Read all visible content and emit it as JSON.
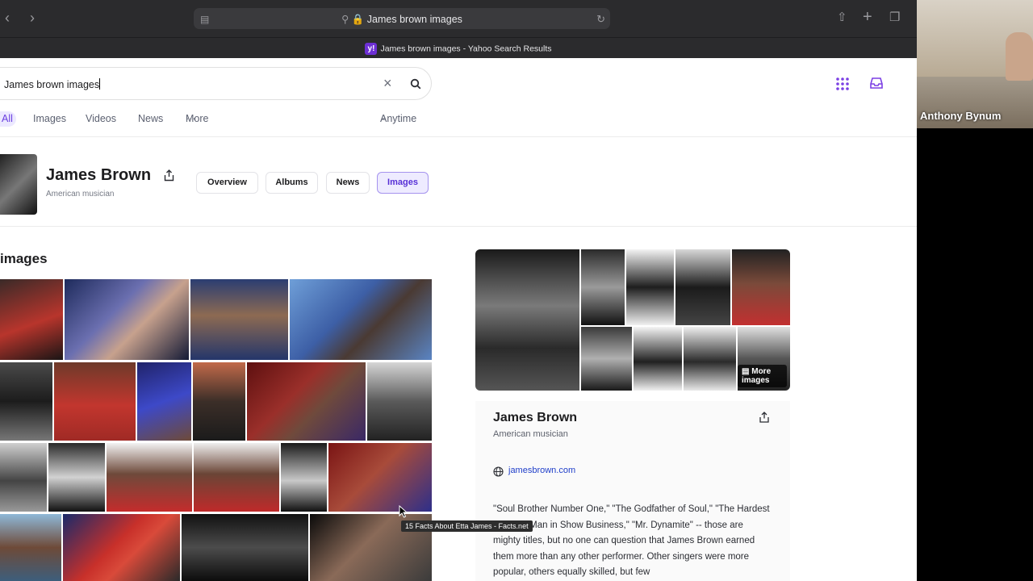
{
  "browser": {
    "url_text": "James brown images",
    "tab_title": "James brown images - Yahoo Search Results"
  },
  "search": {
    "query": "James brown images"
  },
  "nav_tabs": [
    "All",
    "Images",
    "Videos",
    "News",
    "More",
    "Anytime"
  ],
  "knowledge_header": {
    "name": "James Brown",
    "subtitle": "American musician",
    "pills": [
      "Overview",
      "Albums",
      "News",
      "Images"
    ],
    "active_pill": "Images"
  },
  "images_section": {
    "title": "images"
  },
  "side_card": {
    "more_images_label": "More images",
    "name": "James Brown",
    "subtitle": "American musician",
    "website": "jamesbrown.com",
    "description": "\"Soul Brother Number One,\" \"The Godfather of Soul,\" \"The Hardest Working Man in Show Business,\" \"Mr. Dynamite\" -- those are mighty titles, but no one can question that James Brown earned them more than any other performer. Other singers were more popular, others equally skilled, but few"
  },
  "tooltip": "15 Facts About Etta James - Facts.net",
  "video_call": {
    "participant_name": "Anthony Bynum"
  },
  "colors": {
    "accent": "#6a3fe0",
    "toolbar": "#2b2b2d"
  }
}
